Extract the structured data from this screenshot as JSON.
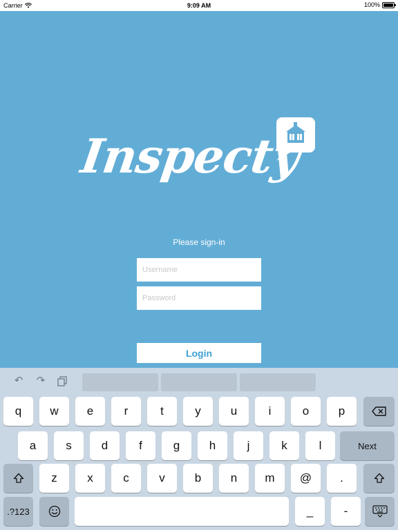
{
  "status_bar": {
    "carrier": "Carrier",
    "time": "9:09 AM",
    "battery": "100%"
  },
  "logo": {
    "text": "Inspecty"
  },
  "signin": {
    "prompt": "Please sign-in",
    "username_placeholder": "Username",
    "password_placeholder": "Password",
    "login_label": "Login"
  },
  "keyboard": {
    "row1": [
      "q",
      "w",
      "e",
      "r",
      "t",
      "y",
      "u",
      "i",
      "o",
      "p"
    ],
    "row2": [
      "a",
      "s",
      "d",
      "f",
      "g",
      "h",
      "j",
      "k",
      "l"
    ],
    "row3": [
      "z",
      "x",
      "c",
      "v",
      "b",
      "n",
      "m",
      "@",
      "."
    ],
    "next_label": "Next",
    "numbers_label": ".?123",
    "underscore": "_",
    "dash": "-"
  },
  "colors": {
    "background": "#62add6",
    "login_text": "#3f9fd1",
    "keyboard_bg": "#c9d6e3"
  }
}
